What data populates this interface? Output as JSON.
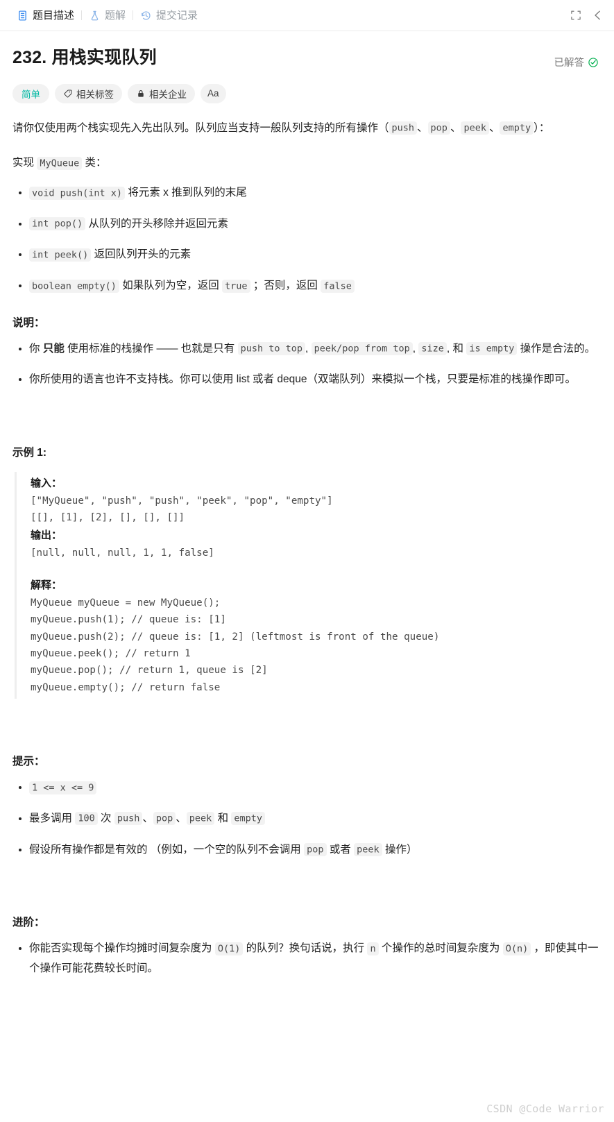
{
  "tabbar": {
    "tabs": [
      {
        "id": "description",
        "label": "题目描述",
        "icon": "document-icon",
        "active": true
      },
      {
        "id": "solution",
        "label": "题解",
        "icon": "flask-icon",
        "active": false
      },
      {
        "id": "submissions",
        "label": "提交记录",
        "icon": "history-icon",
        "active": false
      }
    ],
    "right_icons": [
      {
        "id": "fullscreen",
        "name": "fullscreen-icon"
      },
      {
        "id": "collapse",
        "name": "chevron-left-icon"
      }
    ]
  },
  "problem": {
    "title": "232. 用栈实现队列",
    "status_label": "已解答",
    "status_color": "#00af4e",
    "difficulty": "简单",
    "difficulty_color": "#00b8a3",
    "pills": [
      {
        "id": "tags",
        "label": "相关标签",
        "icon": "tag-icon"
      },
      {
        "id": "companies",
        "label": "相关企业",
        "icon": "lock-icon"
      },
      {
        "id": "font",
        "label": "Aa",
        "icon": "font-size-icon"
      }
    ]
  },
  "description": {
    "intro_1a": "请你仅使用两个栈实现先入先出队列。队列应当支持一般队列支持的所有操作（",
    "intro_code_1": "push",
    "intro_1b": "、",
    "intro_code_2": "pop",
    "intro_1c": "、",
    "intro_code_3": "peek",
    "intro_1d": "、",
    "intro_code_4": "empty",
    "intro_1e": "）：",
    "impl_prefix": "实现 ",
    "impl_class": "MyQueue",
    "impl_suffix": " 类：",
    "methods": [
      {
        "code": "void push(int x)",
        "text": " 将元素 x 推到队列的末尾"
      },
      {
        "code": "int pop()",
        "text": " 从队列的开头移除并返回元素"
      },
      {
        "code": "int peek()",
        "text": " 返回队列开头的元素"
      }
    ],
    "method_empty": {
      "code": "boolean empty()",
      "t1": " 如果队列为空，返回 ",
      "c1": "true",
      "t2": " ；否则，返回 ",
      "c2": "false"
    }
  },
  "notes": {
    "heading": "说明：",
    "item1": {
      "a": "你 ",
      "bold": "只能",
      "b": " 使用标准的栈操作 —— 也就是只有 ",
      "c1": "push to top",
      "c": ", ",
      "c2": "peek/pop from top",
      "d": ", ",
      "c3": "size",
      "e": ", 和 ",
      "c4": "is empty",
      "f": " 操作是合法的。"
    },
    "item2": "你所使用的语言也许不支持栈。你可以使用 list 或者 deque（双端队列）来模拟一个栈，只要是标准的栈操作即可。"
  },
  "example": {
    "heading": "示例 1:",
    "input_label": "输入：",
    "input_lines": "[\"MyQueue\", \"push\", \"push\", \"peek\", \"pop\", \"empty\"]\n[[], [1], [2], [], [], []]",
    "output_label": "输出：",
    "output_lines": "[null, null, null, 1, 1, false]",
    "explain_label": "解释：",
    "explain_lines": "MyQueue myQueue = new MyQueue();\nmyQueue.push(1); // queue is: [1]\nmyQueue.push(2); // queue is: [1, 2] (leftmost is front of the queue)\nmyQueue.peek(); // return 1\nmyQueue.pop(); // return 1, queue is [2]\nmyQueue.empty(); // return false"
  },
  "hints": {
    "heading": "提示：",
    "item1_code": "1 <= x <= 9",
    "item2": {
      "a": "最多调用 ",
      "c1": "100",
      "b": " 次 ",
      "c2": "push",
      "c": "、",
      "c3": "pop",
      "d": "、",
      "c4": "peek",
      "e": " 和 ",
      "c5": "empty"
    },
    "item3": {
      "a": "假设所有操作都是有效的 （例如，一个空的队列不会调用 ",
      "c1": "pop",
      "b": " 或者 ",
      "c2": "peek",
      "c": " 操作）"
    }
  },
  "followup": {
    "heading": "进阶：",
    "item": {
      "a": "你能否实现每个操作均摊时间复杂度为 ",
      "c1": "O(1)",
      "b": " 的队列？换句话说，执行 ",
      "c2": "n",
      "c": " 个操作的总时间复杂度为 ",
      "c3": "O(n)",
      "d": " ，即使其中一个操作可能花费较长时间。"
    }
  },
  "watermark": "CSDN @Code Warrior"
}
